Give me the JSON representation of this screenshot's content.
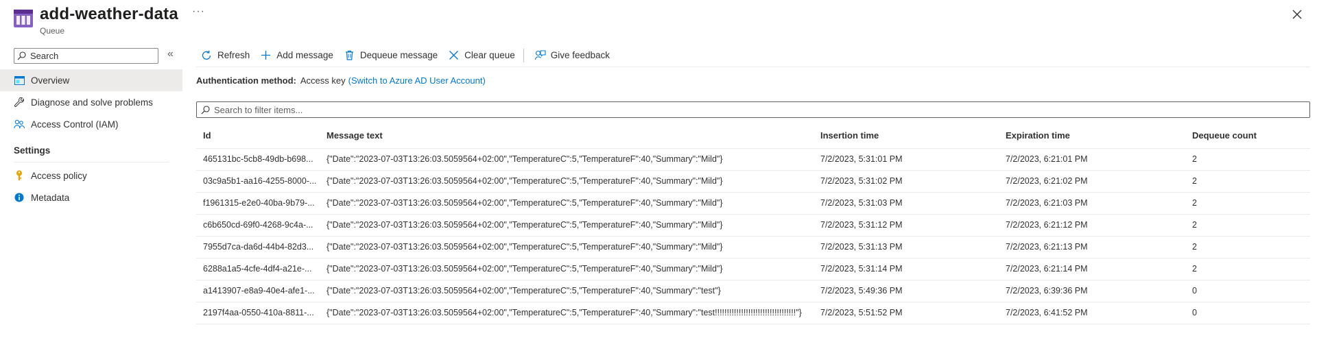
{
  "header": {
    "title": "add-weather-data",
    "subtitle": "Queue",
    "more": "···"
  },
  "sidebar": {
    "search_label": "Search",
    "collapse": "«",
    "items": [
      {
        "label": "Overview",
        "icon": "overview-icon"
      },
      {
        "label": "Diagnose and solve problems",
        "icon": "wrench-icon"
      },
      {
        "label": "Access Control (IAM)",
        "icon": "people-icon"
      }
    ],
    "section_settings": "Settings",
    "settings_items": [
      {
        "label": "Access policy",
        "icon": "key-icon"
      },
      {
        "label": "Metadata",
        "icon": "info-icon"
      }
    ]
  },
  "toolbar": {
    "refresh": "Refresh",
    "add_message": "Add message",
    "dequeue_message": "Dequeue message",
    "clear_queue": "Clear queue",
    "give_feedback": "Give feedback"
  },
  "auth": {
    "label": "Authentication method:",
    "value": "Access key",
    "link": "(Switch to Azure AD User Account)"
  },
  "filter": {
    "placeholder": "Search to filter items..."
  },
  "table": {
    "columns": [
      "Id",
      "Message text",
      "Insertion time",
      "Expiration time",
      "Dequeue count"
    ],
    "rows": [
      [
        "465131bc-5cb8-49db-b698...",
        "{\"Date\":\"2023-07-03T13:26:03.5059564+02:00\",\"TemperatureC\":5,\"TemperatureF\":40,\"Summary\":\"Mild\"}",
        "7/2/2023, 5:31:01 PM",
        "7/2/2023, 6:21:01 PM",
        "2"
      ],
      [
        "03c9a5b1-aa16-4255-8000-...",
        "{\"Date\":\"2023-07-03T13:26:03.5059564+02:00\",\"TemperatureC\":5,\"TemperatureF\":40,\"Summary\":\"Mild\"}",
        "7/2/2023, 5:31:02 PM",
        "7/2/2023, 6:21:02 PM",
        "2"
      ],
      [
        "f1961315-e2e0-40ba-9b79-...",
        "{\"Date\":\"2023-07-03T13:26:03.5059564+02:00\",\"TemperatureC\":5,\"TemperatureF\":40,\"Summary\":\"Mild\"}",
        "7/2/2023, 5:31:03 PM",
        "7/2/2023, 6:21:03 PM",
        "2"
      ],
      [
        "c6b650cd-69f0-4268-9c4a-...",
        "{\"Date\":\"2023-07-03T13:26:03.5059564+02:00\",\"TemperatureC\":5,\"TemperatureF\":40,\"Summary\":\"Mild\"}",
        "7/2/2023, 5:31:12 PM",
        "7/2/2023, 6:21:12 PM",
        "2"
      ],
      [
        "7955d7ca-da6d-44b4-82d3...",
        "{\"Date\":\"2023-07-03T13:26:03.5059564+02:00\",\"TemperatureC\":5,\"TemperatureF\":40,\"Summary\":\"Mild\"}",
        "7/2/2023, 5:31:13 PM",
        "7/2/2023, 6:21:13 PM",
        "2"
      ],
      [
        "6288a1a5-4cfe-4df4-a21e-...",
        "{\"Date\":\"2023-07-03T13:26:03.5059564+02:00\",\"TemperatureC\":5,\"TemperatureF\":40,\"Summary\":\"Mild\"}",
        "7/2/2023, 5:31:14 PM",
        "7/2/2023, 6:21:14 PM",
        "2"
      ],
      [
        "a1413907-e8a9-40e4-afe1-...",
        "{\"Date\":\"2023-07-03T13:26:03.5059564+02:00\",\"TemperatureC\":5,\"TemperatureF\":40,\"Summary\":\"test\"}",
        "7/2/2023, 5:49:36 PM",
        "7/2/2023, 6:39:36 PM",
        "0"
      ],
      [
        "2197f4aa-0550-410a-8811-...",
        "{\"Date\":\"2023-07-03T13:26:03.5059564+02:00\",\"TemperatureC\":5,\"TemperatureF\":40,\"Summary\":\"test!!!!!!!!!!!!!!!!!!!!!!!!!!!!!!!!!!\"}",
        "7/2/2023, 5:51:52 PM",
        "7/2/2023, 6:41:52 PM",
        "0"
      ]
    ]
  },
  "colors": {
    "accent": "#0078d4",
    "queue_icon": "#8661c5",
    "nav_active_bg": "#edebe9",
    "key_icon": "#eaa300"
  }
}
